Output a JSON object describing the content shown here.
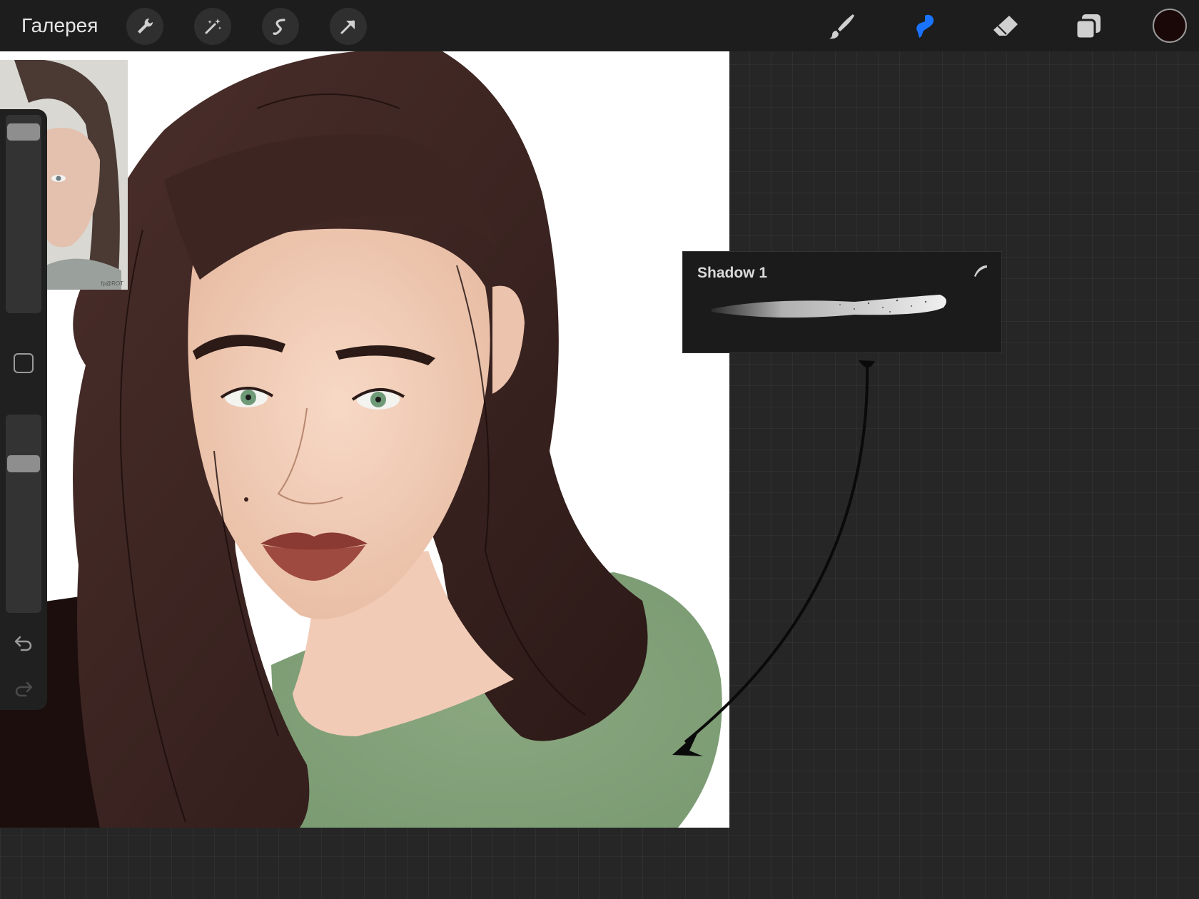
{
  "topbar": {
    "gallery_label": "Галерея",
    "tools_left": [
      "wrench-icon",
      "magic-wand-icon",
      "selection-icon",
      "transform-arrow-icon"
    ],
    "tools_right": [
      "brush-icon",
      "smudge-icon",
      "eraser-icon",
      "layers-icon"
    ],
    "active_tool": "smudge-icon",
    "active_color": "#1a0808",
    "accent_color": "#1a73ff"
  },
  "sidebar": {
    "brush_size_level": 0.04,
    "opacity_level": 0.22,
    "icons": [
      "modify-square-icon",
      "undo-icon",
      "redo-icon"
    ]
  },
  "reference_image": {
    "caption": "fp@ROT"
  },
  "brush_popup": {
    "brush_name": "Shadow 1"
  }
}
